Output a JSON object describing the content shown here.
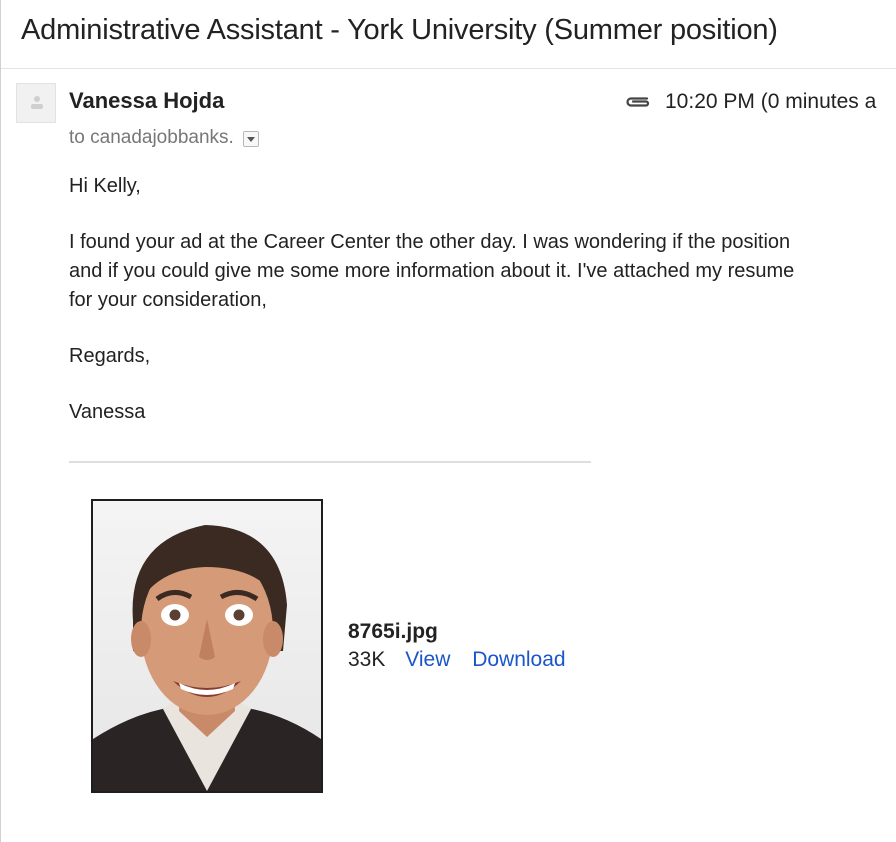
{
  "email": {
    "subject": "Administrative Assistant - York University (Summer position)",
    "sender_name": "Vanessa Hojda",
    "recipient": "to canadajobbanks.",
    "timestamp": "10:20 PM (0 minutes a",
    "body": {
      "greeting": "Hi Kelly,",
      "paragraph_lines": [
        "I found your ad at the Career Center the other day. I was wondering if the position",
        "and if you could give me some more information about it. I've attached my resume",
        "for your consideration,"
      ],
      "closing": "Regards,",
      "signature": "Vanessa"
    },
    "attachment": {
      "filename": "8765i.jpg",
      "size": "33K",
      "view_label": "View",
      "download_label": "Download"
    }
  },
  "icons": {
    "avatar": "person-silhouette-icon",
    "attachment": "paperclip-icon",
    "recipient_details": "dropdown-arrow-icon"
  },
  "colors": {
    "link": "#1a56c9",
    "muted_text": "#777777",
    "text": "#222222"
  }
}
